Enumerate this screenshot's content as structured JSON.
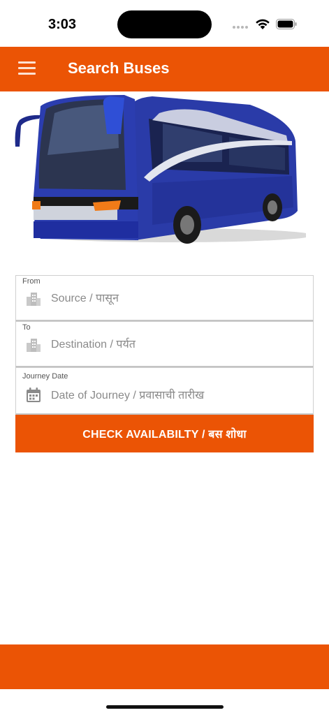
{
  "status_bar": {
    "time": "3:03"
  },
  "header": {
    "title": "Search Buses"
  },
  "form": {
    "from": {
      "label": "From",
      "placeholder": "Source / पासून"
    },
    "to": {
      "label": "To",
      "placeholder": "Destination / पर्यत"
    },
    "date": {
      "label": "Journey Date",
      "placeholder": "Date of Journey / प्रवासाची तारीख"
    },
    "submit_label": "CHECK AVAILABILTY / बस शोधा"
  },
  "colors": {
    "accent": "#EB5405",
    "bus_body": "#2233A8"
  }
}
